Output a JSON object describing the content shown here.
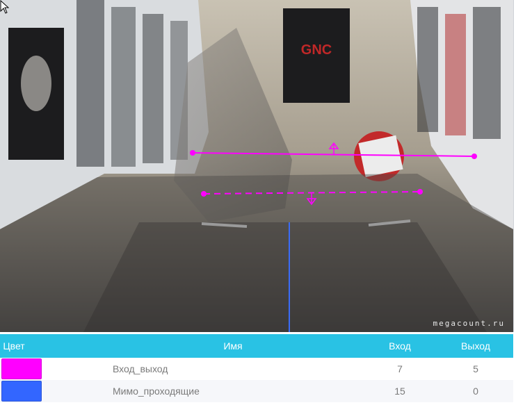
{
  "camera": {
    "watermark": "megacount.ru",
    "store_sign": "GNC",
    "lines": [
      {
        "name": "line-enter-exit",
        "color": "#ff00ff",
        "style": "solid"
      },
      {
        "name": "line-passing",
        "color": "#ff00ff",
        "style": "dashed"
      },
      {
        "name": "line-vertical",
        "color": "#3b6cf6",
        "style": "solid"
      }
    ]
  },
  "table": {
    "headers": {
      "color": "Цвет",
      "name": "Имя",
      "in": "Вход",
      "out": "Выход"
    },
    "rows": [
      {
        "color": "#ff00ff",
        "name": "Вход_выход",
        "in": "7",
        "out": "5"
      },
      {
        "color": "#3366ff",
        "name": "Мимо_проходящие",
        "in": "15",
        "out": "0"
      }
    ]
  },
  "colors": {
    "header_bg": "#29c2e4",
    "magenta": "#ff00ff",
    "blue": "#3366ff"
  }
}
